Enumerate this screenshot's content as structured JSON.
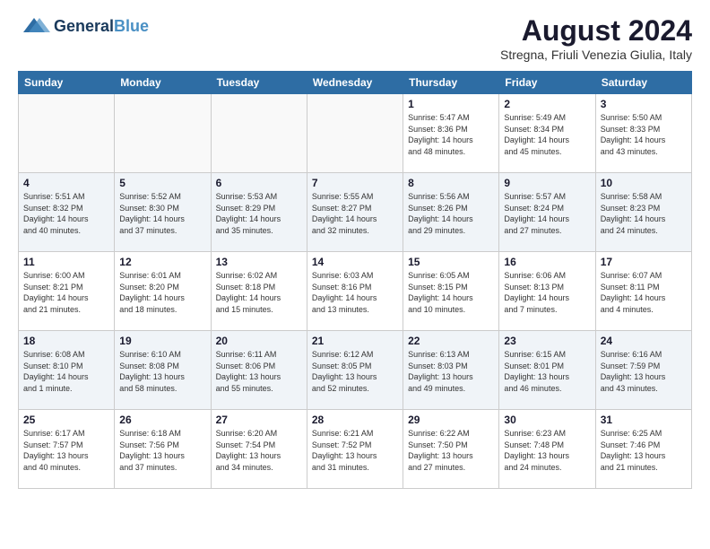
{
  "header": {
    "logo_line1": "General",
    "logo_line2": "Blue",
    "main_title": "August 2024",
    "subtitle": "Stregna, Friuli Venezia Giulia, Italy"
  },
  "days_of_week": [
    "Sunday",
    "Monday",
    "Tuesday",
    "Wednesday",
    "Thursday",
    "Friday",
    "Saturday"
  ],
  "weeks": [
    [
      {
        "day": "",
        "info": ""
      },
      {
        "day": "",
        "info": ""
      },
      {
        "day": "",
        "info": ""
      },
      {
        "day": "",
        "info": ""
      },
      {
        "day": "1",
        "info": "Sunrise: 5:47 AM\nSunset: 8:36 PM\nDaylight: 14 hours\nand 48 minutes."
      },
      {
        "day": "2",
        "info": "Sunrise: 5:49 AM\nSunset: 8:34 PM\nDaylight: 14 hours\nand 45 minutes."
      },
      {
        "day": "3",
        "info": "Sunrise: 5:50 AM\nSunset: 8:33 PM\nDaylight: 14 hours\nand 43 minutes."
      }
    ],
    [
      {
        "day": "4",
        "info": "Sunrise: 5:51 AM\nSunset: 8:32 PM\nDaylight: 14 hours\nand 40 minutes."
      },
      {
        "day": "5",
        "info": "Sunrise: 5:52 AM\nSunset: 8:30 PM\nDaylight: 14 hours\nand 37 minutes."
      },
      {
        "day": "6",
        "info": "Sunrise: 5:53 AM\nSunset: 8:29 PM\nDaylight: 14 hours\nand 35 minutes."
      },
      {
        "day": "7",
        "info": "Sunrise: 5:55 AM\nSunset: 8:27 PM\nDaylight: 14 hours\nand 32 minutes."
      },
      {
        "day": "8",
        "info": "Sunrise: 5:56 AM\nSunset: 8:26 PM\nDaylight: 14 hours\nand 29 minutes."
      },
      {
        "day": "9",
        "info": "Sunrise: 5:57 AM\nSunset: 8:24 PM\nDaylight: 14 hours\nand 27 minutes."
      },
      {
        "day": "10",
        "info": "Sunrise: 5:58 AM\nSunset: 8:23 PM\nDaylight: 14 hours\nand 24 minutes."
      }
    ],
    [
      {
        "day": "11",
        "info": "Sunrise: 6:00 AM\nSunset: 8:21 PM\nDaylight: 14 hours\nand 21 minutes."
      },
      {
        "day": "12",
        "info": "Sunrise: 6:01 AM\nSunset: 8:20 PM\nDaylight: 14 hours\nand 18 minutes."
      },
      {
        "day": "13",
        "info": "Sunrise: 6:02 AM\nSunset: 8:18 PM\nDaylight: 14 hours\nand 15 minutes."
      },
      {
        "day": "14",
        "info": "Sunrise: 6:03 AM\nSunset: 8:16 PM\nDaylight: 14 hours\nand 13 minutes."
      },
      {
        "day": "15",
        "info": "Sunrise: 6:05 AM\nSunset: 8:15 PM\nDaylight: 14 hours\nand 10 minutes."
      },
      {
        "day": "16",
        "info": "Sunrise: 6:06 AM\nSunset: 8:13 PM\nDaylight: 14 hours\nand 7 minutes."
      },
      {
        "day": "17",
        "info": "Sunrise: 6:07 AM\nSunset: 8:11 PM\nDaylight: 14 hours\nand 4 minutes."
      }
    ],
    [
      {
        "day": "18",
        "info": "Sunrise: 6:08 AM\nSunset: 8:10 PM\nDaylight: 14 hours\nand 1 minute."
      },
      {
        "day": "19",
        "info": "Sunrise: 6:10 AM\nSunset: 8:08 PM\nDaylight: 13 hours\nand 58 minutes."
      },
      {
        "day": "20",
        "info": "Sunrise: 6:11 AM\nSunset: 8:06 PM\nDaylight: 13 hours\nand 55 minutes."
      },
      {
        "day": "21",
        "info": "Sunrise: 6:12 AM\nSunset: 8:05 PM\nDaylight: 13 hours\nand 52 minutes."
      },
      {
        "day": "22",
        "info": "Sunrise: 6:13 AM\nSunset: 8:03 PM\nDaylight: 13 hours\nand 49 minutes."
      },
      {
        "day": "23",
        "info": "Sunrise: 6:15 AM\nSunset: 8:01 PM\nDaylight: 13 hours\nand 46 minutes."
      },
      {
        "day": "24",
        "info": "Sunrise: 6:16 AM\nSunset: 7:59 PM\nDaylight: 13 hours\nand 43 minutes."
      }
    ],
    [
      {
        "day": "25",
        "info": "Sunrise: 6:17 AM\nSunset: 7:57 PM\nDaylight: 13 hours\nand 40 minutes."
      },
      {
        "day": "26",
        "info": "Sunrise: 6:18 AM\nSunset: 7:56 PM\nDaylight: 13 hours\nand 37 minutes."
      },
      {
        "day": "27",
        "info": "Sunrise: 6:20 AM\nSunset: 7:54 PM\nDaylight: 13 hours\nand 34 minutes."
      },
      {
        "day": "28",
        "info": "Sunrise: 6:21 AM\nSunset: 7:52 PM\nDaylight: 13 hours\nand 31 minutes."
      },
      {
        "day": "29",
        "info": "Sunrise: 6:22 AM\nSunset: 7:50 PM\nDaylight: 13 hours\nand 27 minutes."
      },
      {
        "day": "30",
        "info": "Sunrise: 6:23 AM\nSunset: 7:48 PM\nDaylight: 13 hours\nand 24 minutes."
      },
      {
        "day": "31",
        "info": "Sunrise: 6:25 AM\nSunset: 7:46 PM\nDaylight: 13 hours\nand 21 minutes."
      }
    ]
  ]
}
